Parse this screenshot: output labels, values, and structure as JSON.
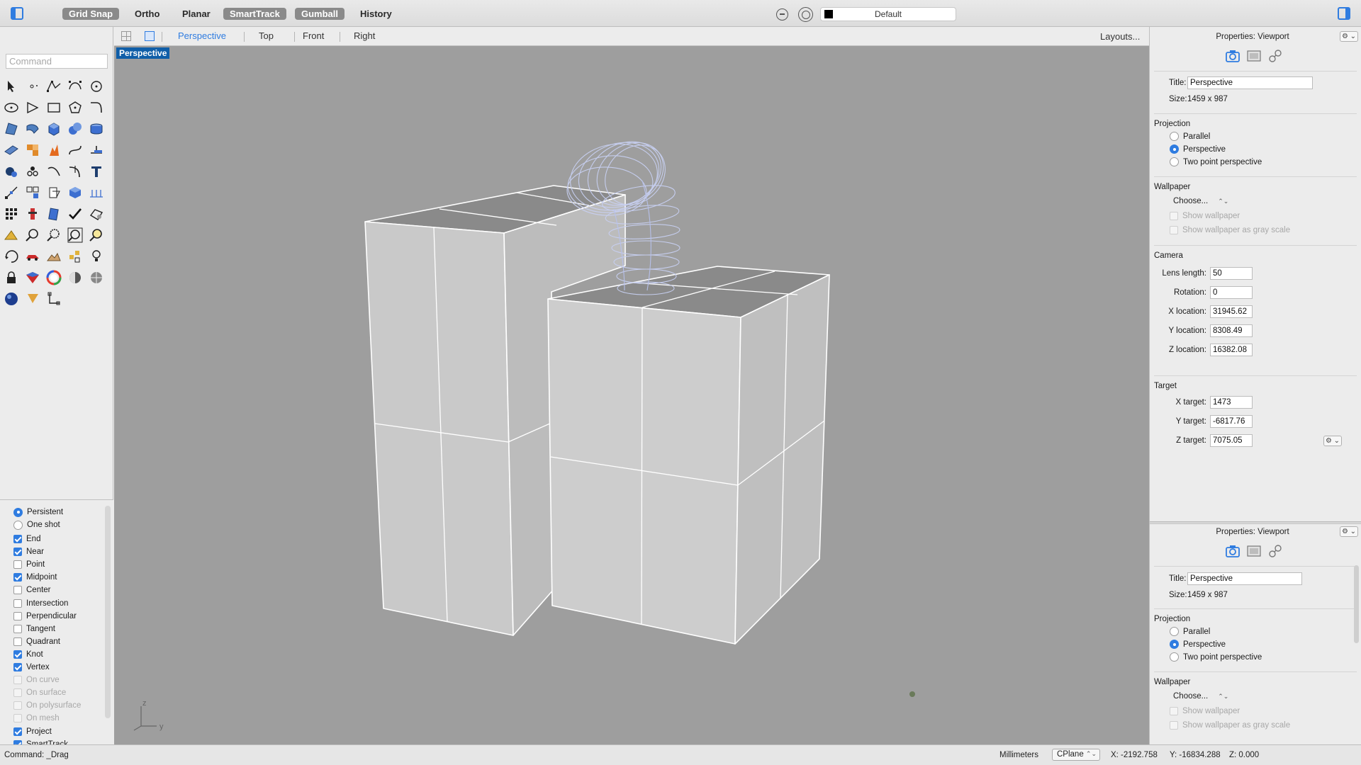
{
  "toolbar": {
    "modes": [
      {
        "label": "Grid Snap",
        "on": true
      },
      {
        "label": "Ortho",
        "on": false
      },
      {
        "label": "Planar",
        "on": false
      },
      {
        "label": "SmartTrack",
        "on": true
      },
      {
        "label": "Gumball",
        "on": true
      },
      {
        "label": "History",
        "on": false
      }
    ],
    "layer": "Default",
    "layer_color": "#000000"
  },
  "command": {
    "placeholder": "Command"
  },
  "viewport_tabs": {
    "tabs": [
      "Perspective",
      "Top",
      "Front",
      "Right"
    ],
    "active": "Perspective",
    "layouts_label": "Layouts..."
  },
  "viewport": {
    "label": "Perspective",
    "axis_z": "z",
    "axis_y": "y"
  },
  "osnap": {
    "modes": [
      {
        "label": "Persistent",
        "checked": true
      },
      {
        "label": "One shot",
        "checked": false
      }
    ],
    "items": [
      {
        "label": "End",
        "checked": true,
        "enabled": true
      },
      {
        "label": "Near",
        "checked": true,
        "enabled": true
      },
      {
        "label": "Point",
        "checked": false,
        "enabled": true
      },
      {
        "label": "Midpoint",
        "checked": true,
        "enabled": true
      },
      {
        "label": "Center",
        "checked": false,
        "enabled": true
      },
      {
        "label": "Intersection",
        "checked": false,
        "enabled": true
      },
      {
        "label": "Perpendicular",
        "checked": false,
        "enabled": true
      },
      {
        "label": "Tangent",
        "checked": false,
        "enabled": true
      },
      {
        "label": "Quadrant",
        "checked": false,
        "enabled": true
      },
      {
        "label": "Knot",
        "checked": true,
        "enabled": true
      },
      {
        "label": "Vertex",
        "checked": true,
        "enabled": true
      },
      {
        "label": "On curve",
        "checked": false,
        "enabled": false
      },
      {
        "label": "On surface",
        "checked": false,
        "enabled": false
      },
      {
        "label": "On polysurface",
        "checked": false,
        "enabled": false
      },
      {
        "label": "On mesh",
        "checked": false,
        "enabled": false
      },
      {
        "label": "Project",
        "checked": true,
        "enabled": true
      },
      {
        "label": "SmartTrack",
        "checked": true,
        "enabled": true
      }
    ]
  },
  "properties_top": {
    "header": "Properties: Viewport",
    "title_label": "Title:",
    "title_value": "Perspective",
    "size_label": "Size:",
    "size_value": "1459 x 987",
    "projection_label": "Projection",
    "projection_options": [
      "Parallel",
      "Perspective",
      "Two point perspective"
    ],
    "projection_selected": "Perspective",
    "wallpaper_label": "Wallpaper",
    "wallpaper_choose": "Choose...",
    "show_wallpaper": "Show wallpaper",
    "show_wallpaper_gray": "Show wallpaper as gray scale",
    "camera_label": "Camera",
    "lens_label": "Lens length:",
    "lens_value": "50",
    "rotation_label": "Rotation:",
    "rotation_value": "0",
    "xloc_label": "X location:",
    "xloc_value": "31945.62",
    "yloc_label": "Y location:",
    "yloc_value": "8308.49",
    "zloc_label": "Z location:",
    "zloc_value": "16382.08",
    "target_label": "Target",
    "xtarget_label": "X target:",
    "xtarget_value": "1473",
    "ytarget_label": "Y target:",
    "ytarget_value": "-6817.76",
    "ztarget_label": "Z target:",
    "ztarget_value": "7075.05"
  },
  "properties_bottom": {
    "header": "Properties: Viewport",
    "title_label": "Title:",
    "title_value": "Perspective",
    "size_label": "Size:",
    "size_value": "1459 x 987",
    "projection_label": "Projection",
    "projection_options": [
      "Parallel",
      "Perspective",
      "Two point perspective"
    ],
    "projection_selected": "Perspective",
    "wallpaper_label": "Wallpaper",
    "wallpaper_choose": "Choose...",
    "show_wallpaper": "Show wallpaper",
    "show_wallpaper_gray": "Show wallpaper as gray scale"
  },
  "status": {
    "command": "Command: _Drag",
    "units": "Millimeters",
    "cplane": "CPlane",
    "x": "X: -2192.758",
    "y": "Y: -16834.288",
    "z": "Z: 0.000"
  },
  "colors": {
    "accent": "#2f7ce0",
    "viewport_bg": "#9e9e9e",
    "label_bg": "#0f5ea8"
  }
}
